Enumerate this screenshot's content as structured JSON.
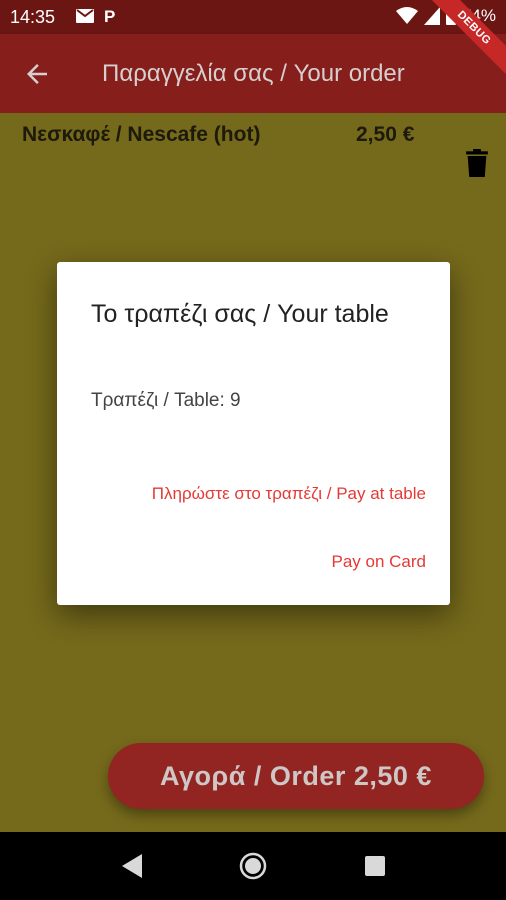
{
  "status_bar": {
    "time": "14:35",
    "p_label": "P",
    "battery": "74%"
  },
  "debug_label": "DEBUG",
  "app_bar": {
    "title": "Παραγγελία σας / Your order"
  },
  "order": {
    "items": [
      {
        "name": "Νεσκαφέ / Nescafe (hot)",
        "price": "2,50 €"
      }
    ]
  },
  "dialog": {
    "title": "Το τραπέζι σας / Your table",
    "text": "Τραπέζι / Table: 9",
    "actions": {
      "pay_at_table": "Πληρώστε στο τραπέζι / Pay at table",
      "pay_on_card": "Pay on Card"
    }
  },
  "order_button": "Αγορά / Order 2,50 €",
  "colors": {
    "app_bar": "#861e1b",
    "status_bar": "#6b1613",
    "background": "#75691b",
    "accent": "#e53935"
  },
  "icons": [
    "mail-icon",
    "wifi-icon",
    "signal-icon",
    "battery-icon",
    "back-arrow-icon",
    "delete-icon",
    "nav-back-icon",
    "nav-home-icon",
    "nav-recent-icon"
  ]
}
